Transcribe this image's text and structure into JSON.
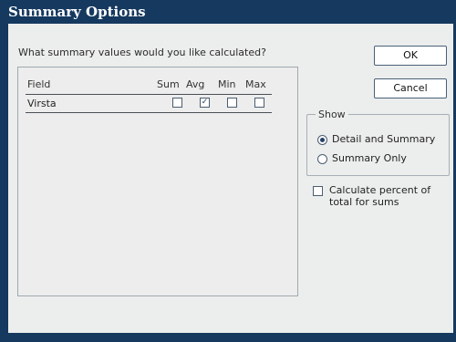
{
  "window": {
    "title": "Summary Options"
  },
  "prompt": "What summary values would you like calculated?",
  "table": {
    "headers": {
      "field": "Field",
      "sum": "Sum",
      "avg": "Avg",
      "min": "Min",
      "max": "Max"
    },
    "rows": [
      {
        "field": "Virsta",
        "sum": false,
        "avg": true,
        "min": false,
        "max": false
      }
    ]
  },
  "buttons": {
    "ok": "OK",
    "cancel": "Cancel"
  },
  "show_group": {
    "label": "Show",
    "options": [
      {
        "label": "Detail and Summary",
        "selected": true
      },
      {
        "label": "Summary Only",
        "selected": false
      }
    ]
  },
  "percent_option": {
    "label": "Calculate percent of total for sums",
    "checked": false
  },
  "colors": {
    "title_bar": "#16395f",
    "background": "#eceeed",
    "accent": "#24406a"
  }
}
